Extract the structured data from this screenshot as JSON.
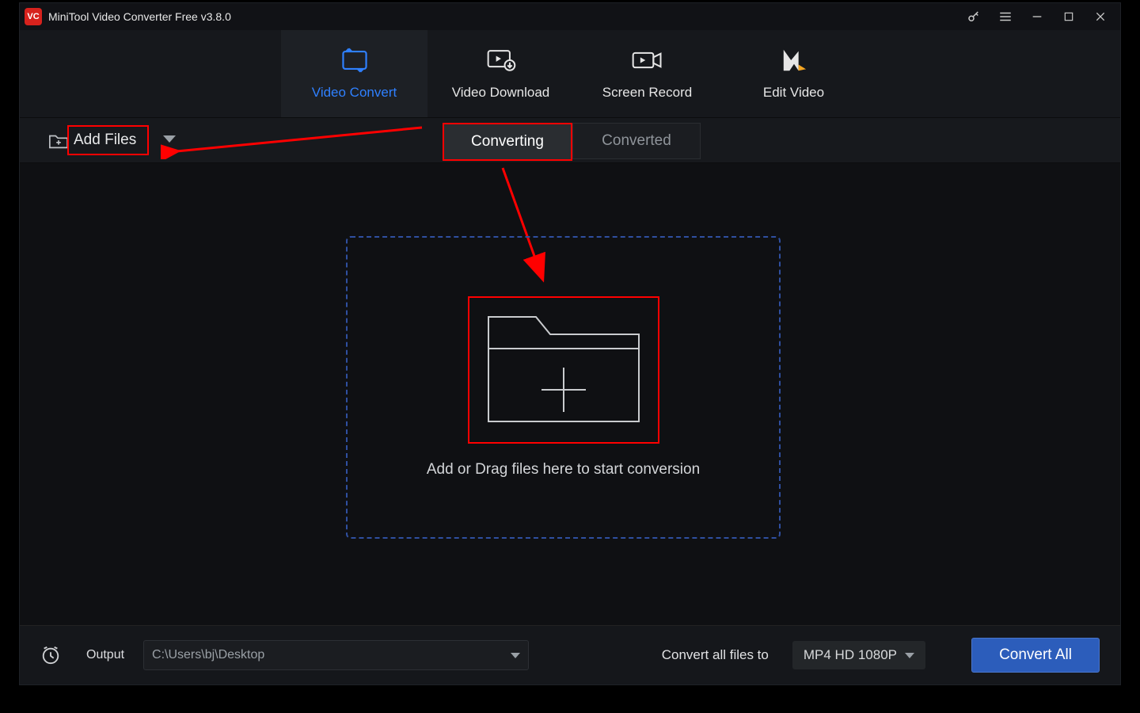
{
  "titlebar": {
    "title": "MiniTool Video Converter Free v3.8.0"
  },
  "mainnav": {
    "items": [
      {
        "label": "Video Convert"
      },
      {
        "label": "Video Download"
      },
      {
        "label": "Screen Record"
      },
      {
        "label": "Edit Video"
      }
    ]
  },
  "toolbar": {
    "add_files_label": "Add Files"
  },
  "subtabs": {
    "converting": "Converting",
    "converted": "Converted"
  },
  "dropzone": {
    "text": "Add or Drag files here to start conversion"
  },
  "bottom": {
    "output_label": "Output",
    "output_path": "C:\\Users\\bj\\Desktop",
    "convert_all_label": "Convert all files to",
    "format": "MP4 HD 1080P",
    "convert_all_btn": "Convert All"
  }
}
